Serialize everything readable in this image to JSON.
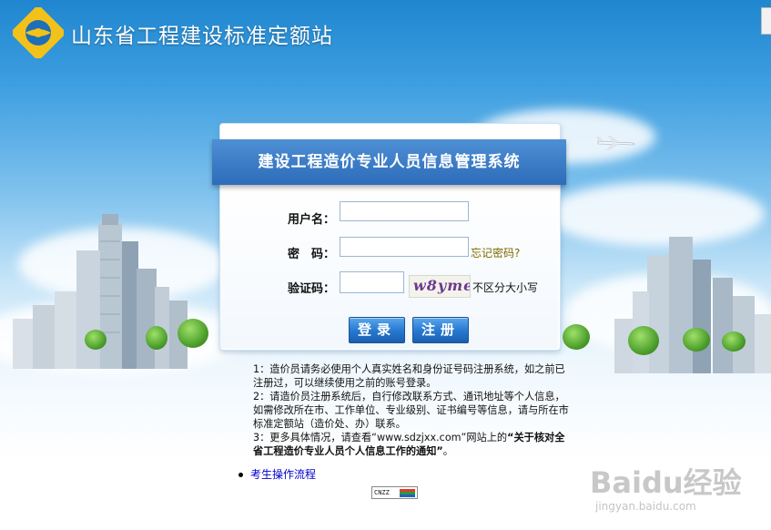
{
  "site": {
    "title": "山东省工程建设标准定额站"
  },
  "login": {
    "system_title": "建设工程造价专业人员信息管理系统",
    "username_label": "用户名：",
    "password_label": "密　码：",
    "captcha_label": "验证码：",
    "username_value": "",
    "password_value": "",
    "captcha_value": "",
    "forgot_password": "忘记密码?",
    "captcha_image_text": "w8yme",
    "captcha_hint": "不区分大小写",
    "login_button": "登录",
    "register_button": "注册"
  },
  "notes": {
    "note1": "1：造价员请务必使用个人真实姓名和身份证号码注册系统，如之前已注册过，可以继续使用之前的账号登录。",
    "note2": "2：请造价员注册系统后，自行修改联系方式、通讯地址等个人信息，如需修改所在市、工作单位、专业级别、证书编号等信息，请与所在市标准定额站（造价处、办）联系。",
    "note3_prefix": "3：更多具体情况，请查看“www.sdzjxx.com”网站上的",
    "note3_bold": "“关于核对全省工程造价专业人员个人信息工作的通知”",
    "note3_suffix": "。"
  },
  "links": {
    "exam_process": "考生操作流程"
  },
  "counter": {
    "label": "CNZZ"
  },
  "watermark": {
    "brand": "Baidu经验",
    "url": "jingyan.baidu.com"
  },
  "colors": {
    "banner": "#2d6cb9",
    "button": "#2577cf",
    "link": "#0000cc",
    "forgot": "#7a6a00"
  }
}
